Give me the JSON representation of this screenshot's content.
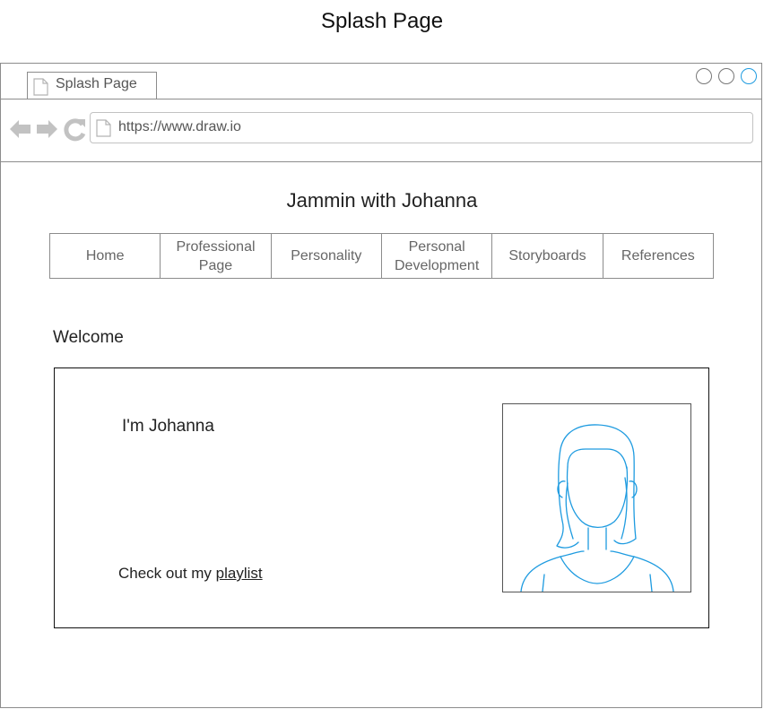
{
  "page_title": "Splash Page",
  "browser": {
    "tab_label": "Splash Page",
    "url": "https://www.draw.io"
  },
  "site": {
    "title": "Jammin with Johanna",
    "nav": [
      {
        "label": "Home"
      },
      {
        "label": "Professional Page"
      },
      {
        "label": "Personality"
      },
      {
        "label": "Personal Development"
      },
      {
        "label": "Storyboards"
      },
      {
        "label": "References"
      }
    ],
    "welcome": "Welcome",
    "greeting": "I'm Johanna",
    "cta_prefix": "Check out my ",
    "cta_link": "playlist"
  },
  "colors": {
    "accent": "#1e9be0",
    "border": "#8c8c8c"
  },
  "icons": [
    "document-icon",
    "back-arrow-icon",
    "forward-arrow-icon",
    "reload-icon",
    "person-placeholder-icon"
  ]
}
